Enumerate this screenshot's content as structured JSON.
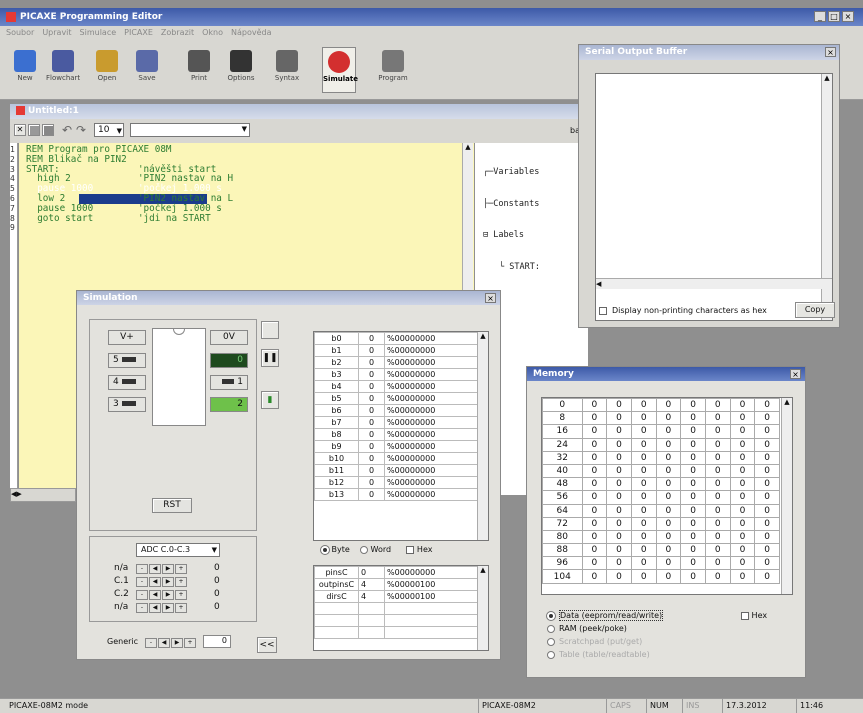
{
  "app": {
    "title": "PICAXE Programming Editor",
    "win_controls": [
      "_",
      "×"
    ]
  },
  "menu": [
    "Soubor",
    "Upravit",
    "Simulace",
    "PICAXE",
    "Zobrazit",
    "Okno",
    "Nápověda"
  ],
  "toolbar": [
    {
      "label": "New",
      "icon": "new-file-icon",
      "color": "#3b6fd0"
    },
    {
      "label": "Flowchart",
      "icon": "flowchart-icon",
      "color": "#4a5aa0"
    },
    {
      "label": "Open",
      "icon": "open-folder-icon",
      "color": "#c99b2e"
    },
    {
      "label": "Save",
      "icon": "save-icon",
      "color": "#5a6aa8"
    },
    {
      "label": "Print",
      "icon": "print-icon",
      "color": "#555"
    },
    {
      "label": "Options",
      "icon": "options-icon",
      "color": "#333"
    },
    {
      "label": "Syntax",
      "icon": "syntax-check-icon",
      "color": "#666"
    },
    {
      "label": "Simulate",
      "icon": "stop-sign-icon",
      "color": "#d32f2f"
    },
    {
      "label": "Program",
      "icon": "program-icon",
      "color": "#777"
    }
  ],
  "editor": {
    "title": "Untitled:1",
    "font_size": "10",
    "right_label": "ba",
    "line_numbers": [
      "1",
      "2",
      "3",
      "4",
      "5",
      "6",
      "7",
      "8",
      "9"
    ],
    "code": [
      "REM Program pro PICAXE 08M",
      "REM Blikač na PIN2",
      "START:              'návěšti start",
      "  high 2            'PIN2 nastav na H",
      "  pause 1000        'počkej 1.000 s",
      "  low 2             'PIN2 nastav na L",
      "  pause 1000        'počkej 1.000 s",
      "  goto start        'jdi na START"
    ],
    "tree": [
      "Variables",
      "Constants",
      "Labels",
      "START:"
    ]
  },
  "serial": {
    "title": "Serial Output Buffer",
    "checkbox": "Display non-printing characters as hex",
    "copy": "Copy"
  },
  "sim": {
    "title": "Simulation",
    "vplus": "V+",
    "zero": "0V",
    "pins_left": [
      "5",
      "4",
      "3"
    ],
    "pins_right": [
      "0",
      "1",
      "2"
    ],
    "rst": "RST",
    "adc": "ADC C.0-C.3",
    "adc_rows": [
      {
        "label": "n/a",
        "val": "0"
      },
      {
        "label": "C.1",
        "val": "0"
      },
      {
        "label": "C.2",
        "val": "0"
      },
      {
        "label": "n/a",
        "val": "0"
      }
    ],
    "generic": "Generic",
    "generic_val": "0",
    "back": "<<",
    "regs": [
      [
        "b0",
        "0",
        "%00000000"
      ],
      [
        "b1",
        "0",
        "%00000000"
      ],
      [
        "b2",
        "0",
        "%00000000"
      ],
      [
        "b3",
        "0",
        "%00000000"
      ],
      [
        "b4",
        "0",
        "%00000000"
      ],
      [
        "b5",
        "0",
        "%00000000"
      ],
      [
        "b6",
        "0",
        "%00000000"
      ],
      [
        "b7",
        "0",
        "%00000000"
      ],
      [
        "b8",
        "0",
        "%00000000"
      ],
      [
        "b9",
        "0",
        "%00000000"
      ],
      [
        "b10",
        "0",
        "%00000000"
      ],
      [
        "b11",
        "0",
        "%00000000"
      ],
      [
        "b12",
        "0",
        "%00000000"
      ],
      [
        "b13",
        "0",
        "%00000000"
      ]
    ],
    "radio_byte": "Byte",
    "radio_word": "Word",
    "hex": "Hex",
    "ports": [
      [
        "pinsC",
        "0",
        "%00000000"
      ],
      [
        "outpinsC",
        "4",
        "%00000100"
      ],
      [
        "dirsC",
        "4",
        "%00000100"
      ],
      [
        "",
        "",
        ""
      ],
      [
        "",
        "",
        ""
      ],
      [
        "",
        "",
        ""
      ]
    ]
  },
  "memory": {
    "title": "Memory",
    "addresses": [
      "0",
      "8",
      "16",
      "24",
      "32",
      "40",
      "48",
      "56",
      "64",
      "72",
      "80",
      "88",
      "96",
      "104"
    ],
    "cell": "0",
    "options": [
      "Data (eeprom/read/write)",
      "RAM (peek/poke)",
      "Scratchpad (put/get)",
      "Table (table/readtable)"
    ],
    "hex": "Hex"
  },
  "status": {
    "mode": "PICAXE-08M2 mode",
    "chip": "PICAXE-08M2",
    "caps": "CAPS",
    "num": "NUM",
    "ins": "INS",
    "date": "17.3.2012",
    "time": "11:46"
  }
}
